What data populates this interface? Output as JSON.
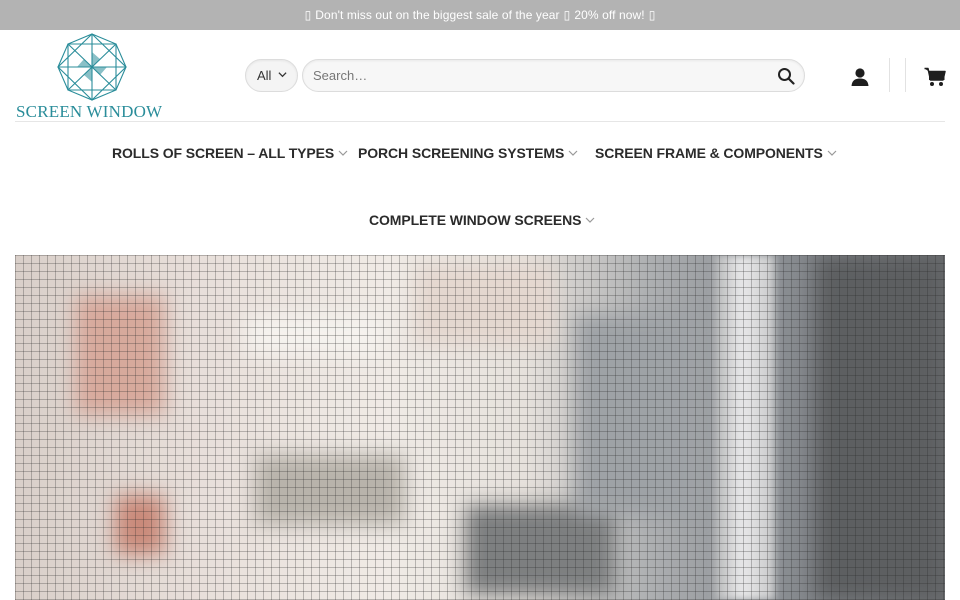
{
  "announcement": {
    "text": "Don't miss out on the biggest sale of the year",
    "offer": "20% off now!",
    "glyph": "▯"
  },
  "logo": {
    "text": "SCREEN WINDOW",
    "color": "#2a8d9a"
  },
  "search": {
    "category_selected": "All",
    "placeholder": "Search…",
    "value": ""
  },
  "header": {
    "account_icon": "user-icon",
    "cart_icon": "cart-icon"
  },
  "nav": {
    "items": [
      {
        "label": "ROLLS OF SCREEN – ALL TYPES"
      },
      {
        "label": "PORCH SCREENING SYSTEMS"
      },
      {
        "label": "SCREEN FRAME & COMPONENTS"
      },
      {
        "label": "COMPLETE WINDOW SCREENS"
      }
    ]
  },
  "colors": {
    "topbar_bg": "#b3b3b3",
    "brand_teal": "#2a8d9a",
    "nav_text": "#2b2b2b"
  }
}
